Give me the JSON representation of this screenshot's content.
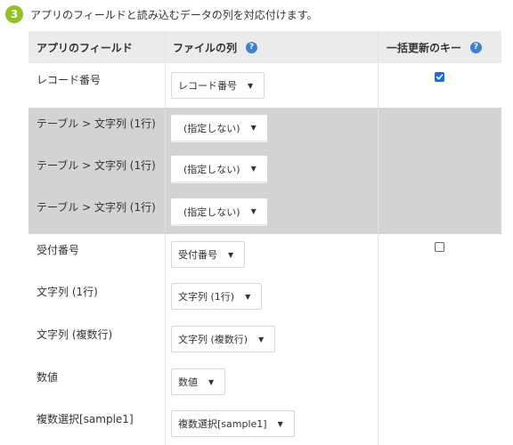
{
  "step": {
    "number": "3",
    "instruction": "アプリのフィールドと読み込むデータの列を対応付けます。"
  },
  "table": {
    "headers": {
      "app_field": "アプリのフィールド",
      "file_column": "ファイルの列",
      "bulk_update_key": "一括更新のキー"
    },
    "help_icon_glyph": "?",
    "rows": [
      {
        "field": "レコード番号",
        "mapping": "レコード番号",
        "key_checked": true
      },
      {
        "field": "テーブル > 文字列 (1行)",
        "mapping": "(指定しない)"
      },
      {
        "field": "テーブル > 文字列 (1行)",
        "mapping": "(指定しない)"
      },
      {
        "field": "テーブル > 文字列 (1行)",
        "mapping": "(指定しない)"
      },
      {
        "field": "受付番号",
        "mapping": "受付番号",
        "key_checked": false
      },
      {
        "field": "文字列 (1行)",
        "mapping": "文字列 (1行)"
      },
      {
        "field": "文字列 (複数行)",
        "mapping": "文字列 (複数行)"
      },
      {
        "field": "数値",
        "mapping": "数値"
      },
      {
        "field": "複数選択[sample1]",
        "mapping": "複数選択[sample1]"
      }
    ]
  },
  "colors": {
    "step_badge": "#8fc31f",
    "header_bg": "#ebebeb",
    "table_group_bg": "#d3d3d3",
    "help_icon": "#3b82d6",
    "checkbox_checked": "#1d6fd3"
  },
  "icons": {
    "dropdown": "caret-down-icon",
    "help": "question-circle-icon",
    "checked": "checkbox-checked-icon",
    "unchecked": "checkbox-empty-icon"
  }
}
